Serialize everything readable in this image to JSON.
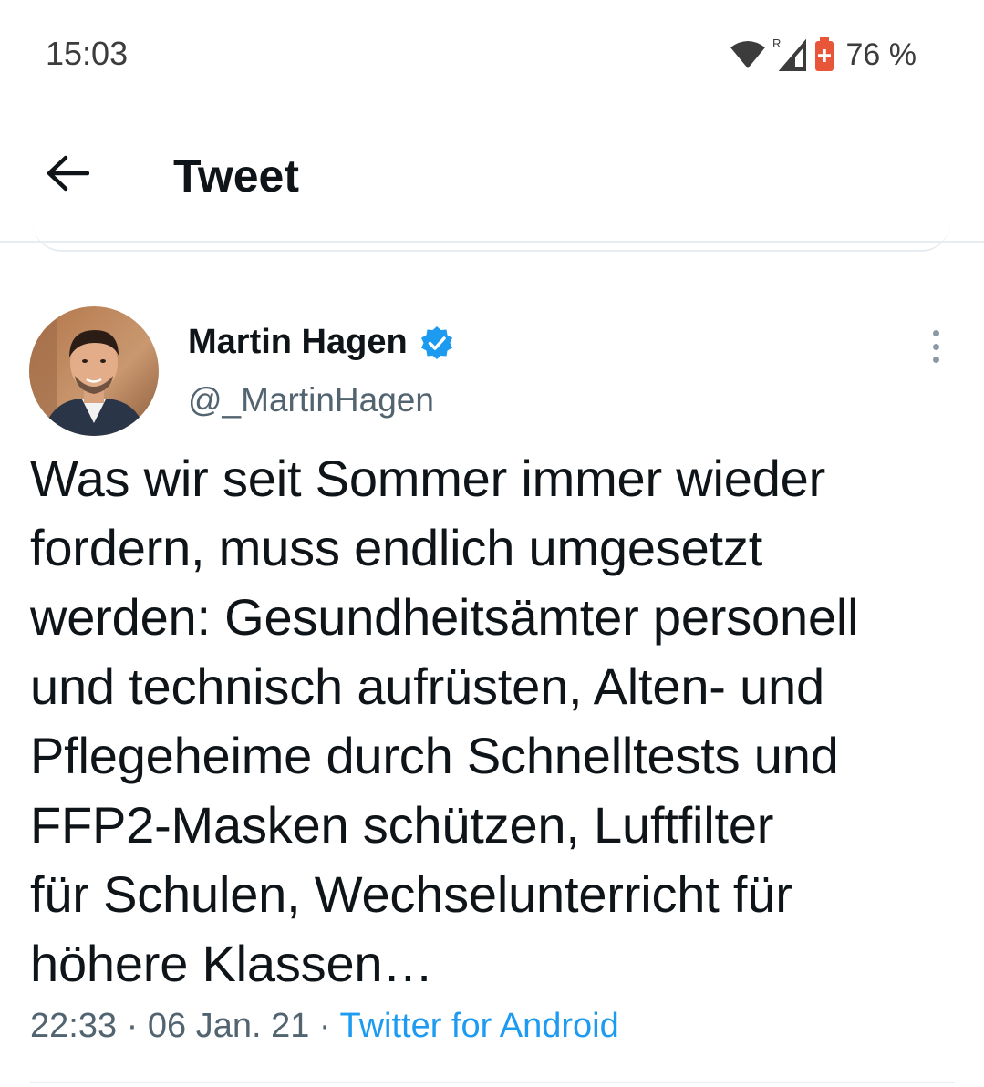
{
  "status_bar": {
    "time": "15:03",
    "battery_percent": "76 %",
    "icons": [
      "wifi-icon",
      "signal-roaming-icon",
      "battery-saver-icon"
    ],
    "roaming_label": "R",
    "battery_color": "#e8563a"
  },
  "header": {
    "back_icon": "arrow-left-icon",
    "title": "Tweet"
  },
  "tweet": {
    "author_name": "Martin Hagen",
    "verified": true,
    "handle": "@_MartinHagen",
    "text": "Was wir seit Sommer immer wieder\nfordern, muss endlich umgesetzt\nwerden: Gesundheitsämter personell\nund technisch aufrüsten, Alten- und\nPflegeheime durch Schnelltests und\nFFP2-Masken schützen, Luftfilter\nfür Schulen, Wechselunterricht für\nhöhere Klassen…",
    "time": "22:33",
    "date": "06 Jan. 21",
    "separator": " · ",
    "source": "Twitter for Android"
  },
  "colors": {
    "accent": "#1d9bf0",
    "text_primary": "#0f1419",
    "text_secondary": "#536471",
    "divider": "#e6ecf0"
  }
}
